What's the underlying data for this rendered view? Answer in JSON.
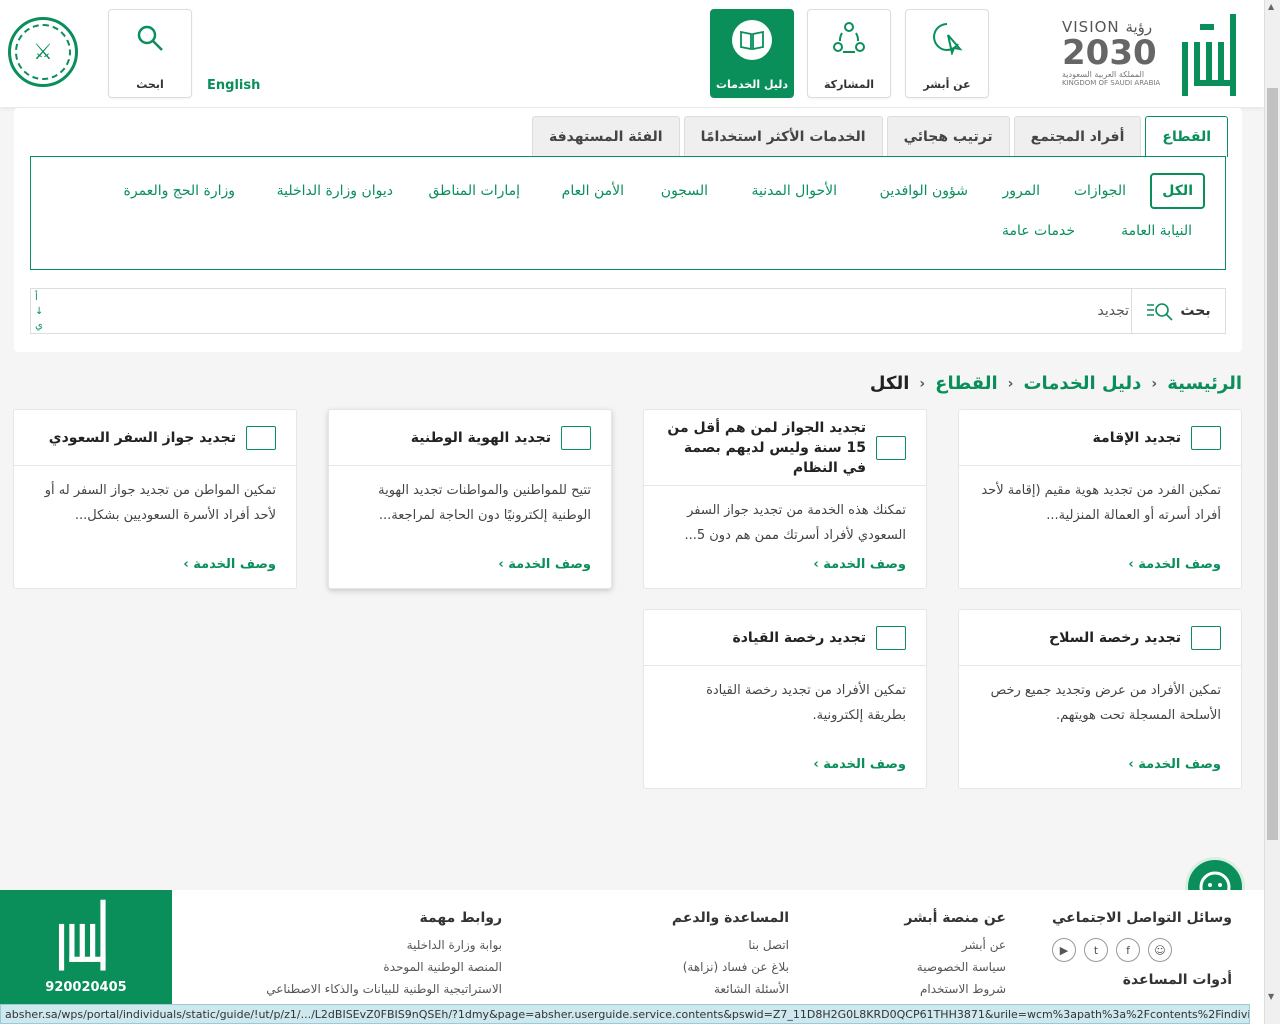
{
  "header": {
    "search_label": "ابحث",
    "english_label": "English",
    "nav": [
      {
        "label": "دليل الخدمات",
        "active": true
      },
      {
        "label": "المشاركة",
        "active": false
      },
      {
        "label": "عن أبشر",
        "active": false
      }
    ],
    "vision": {
      "line1": "VISION رؤية",
      "line2": "2030",
      "line3": "المملكة العربية السعودية",
      "line4": "KINGDOM OF SAUDI ARABIA"
    }
  },
  "tabs": [
    "القطاع",
    "أفراد المجتمع",
    "ترتيب هجائي",
    "الخدمات الأكثر استخدامًا",
    "الفئة المستهدفة"
  ],
  "categories": {
    "row1": [
      "الكل",
      "الجوازات",
      "المرور",
      "شؤون الوافدين",
      "الأحوال المدنية",
      "السجون",
      "الأمن العام",
      "إمارات المناطق",
      "ديوان وزارة الداخلية",
      "وزارة الحج والعمرة"
    ],
    "row2": [
      "النيابة العامة",
      "خدمات عامة"
    ]
  },
  "search": {
    "button_label": "بحث",
    "value": "تجديد",
    "side_hint_1": "أ",
    "side_hint_2": "↓",
    "side_hint_3": "ي"
  },
  "breadcrumb": [
    "الرئيسية",
    "دليل الخدمات",
    "القطاع",
    "الكل"
  ],
  "cards": [
    {
      "title": "تجديد الإقامة",
      "desc": "تمكين الفرد من تجديد هوية مقيم (إقامة لأحد أفراد أسرته أو العمالة المنزلية...",
      "more": "وصف الخدمة ›"
    },
    {
      "title": "تجديد الجواز لمن هم أقل من 15 سنة وليس لديهم بصمة في النظام",
      "desc": "تمكنك هذه الخدمة من تجديد جواز السفر السعودي لأفراد أسرتك ممن هم دون 5...",
      "more": "وصف الخدمة ›"
    },
    {
      "title": "تجديد الهوية الوطنية",
      "desc": "تتيح للمواطنين والمواطنات تجديد الهوية الوطنية إلكترونيًا دون الحاجة لمراجعة...",
      "more": "وصف الخدمة ›"
    },
    {
      "title": "تجديد جواز السفر السعودي",
      "desc": "تمكين المواطن من تجديد جواز السفر له أو لأحد أفراد الأسرة السعوديين بشكل...",
      "more": "وصف الخدمة ›"
    },
    {
      "title": "تجديد رخصة السلاح",
      "desc": "تمكين الأفراد من عرض وتجديد جميع رخص الأسلحة المسجلة تحت هويتهم.",
      "more": "وصف الخدمة ›"
    },
    {
      "title": "تجديد رخصة القيادة",
      "desc": "تمكين الأفراد من تجديد رخصة القيادة بطريقة إلكترونية.",
      "more": "وصف الخدمة ›"
    }
  ],
  "footer": {
    "phone": "920020405",
    "social_title": "وسائل التواصل الاجتماعي",
    "tools_title": "أدوات المساعدة",
    "about_title": "عن منصة أبشر",
    "about_links": [
      "عن أبشر",
      "سياسة الخصوصية",
      "شروط الاستخدام"
    ],
    "help_title": "المساعدة والدعم",
    "help_links": [
      "اتصل بنا",
      "بلاغ عن فساد (نزاهة)",
      "الأسئلة الشائعة"
    ],
    "links_title": "روابط مهمة",
    "links": [
      "بوابة وزارة الداخلية",
      "المنصة الوطنية الموحدة",
      "الاستراتيجية الوطنية للبيانات والذكاء الاصطناعي"
    ]
  },
  "statusbar": "absher.sa/wps/portal/individuals/static/guide/!ut/p/z1/.../L2dBISEvZ0FBIS9nQSEh/?1dmy&page=absher.userguide.service.contents&pswid=Z7_11D8H2G0L8KRD0QCP61THH3871&urile=wcm%3apath%3a%2Fcontents%2Findividuals..."
}
